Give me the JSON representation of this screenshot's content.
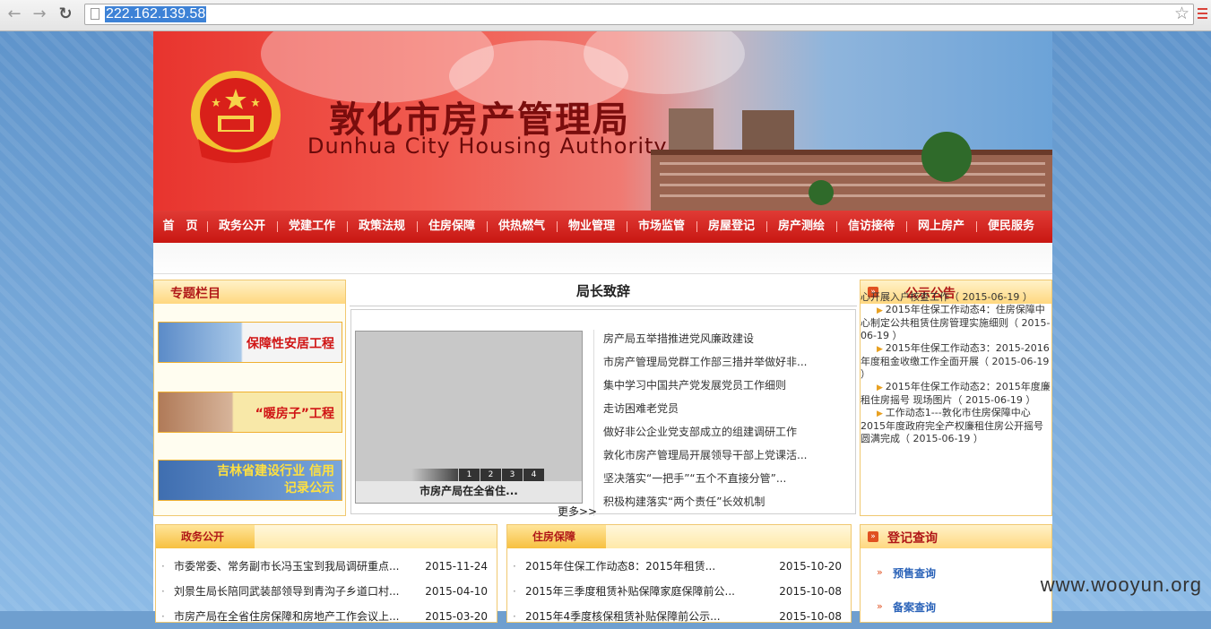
{
  "browser": {
    "url": "222.162.139.58",
    "back_icon": "arrow-left-icon",
    "forward_icon": "arrow-right-icon",
    "reload_icon": "reload-icon"
  },
  "site": {
    "title_cn": "敦化市房产管理局",
    "title_en": "Dunhua City Housing Authority"
  },
  "nav": {
    "items": [
      "首　页",
      "政务公开",
      "党建工作",
      "政策法规",
      "住房保障",
      "供热燃气",
      "物业管理",
      "市场监管",
      "房屋登记",
      "房产测绘",
      "信访接待",
      "网上房产",
      "便民服务"
    ]
  },
  "special": {
    "title": "专题栏目",
    "cards": [
      "保障性安居工程",
      "“暖房子”工程",
      "吉林省建设行业 信用记录公示"
    ]
  },
  "center": {
    "title": "局长致辞",
    "slide_caption": "市房产局在全省住...",
    "slide_pages": [
      "1",
      "2",
      "3",
      "4"
    ],
    "more": "更多>>",
    "news": [
      "房产局五举措推进党风廉政建设",
      "市房产管理局党群工作部三措并举做好非...",
      "集中学习中国共产党发展党员工作细则",
      "走访困难老党员",
      "做好非公企业党支部成立的组建调研工作",
      "敦化市房产管理局开展领导干部上党课活...",
      "坚决落实“一把手”“五个不直接分管”...",
      "积极构建落实“两个责任”长效机制"
    ]
  },
  "notice": {
    "title": "公示公告",
    "lines": [
      "心开展入户核查工作（ 2015-06-19 ）",
      "2015年住保工作动态4：住房保障中心制定公共租赁住房管理实施细则（ 2015-06-19 ）",
      "2015年住保工作动态3：2015-2016年度租金收缴工作全面开展（ 2015-06-19 ）",
      "2015年住保工作动态2：2015年度廉租住房摇号 现场图片（ 2015-06-19 ）",
      "工作动态1---敦化市住房保障中心2015年度政府完全产权廉租住房公开摇号圆满完成（ 2015-06-19 ）"
    ]
  },
  "query": {
    "title": "登记查询",
    "links": [
      "预售查询",
      "备案查询"
    ]
  },
  "gov": {
    "title": "政务公开",
    "rows": [
      {
        "t": "市委常委、常务副市长冯玉宝到我局调研重点...",
        "d": "2015-11-24"
      },
      {
        "t": "刘景生局长陪同武装部领导到青沟子乡道口村...",
        "d": "2015-04-10"
      },
      {
        "t": "市房产局在全省住房保障和房地产工作会议上...",
        "d": "2015-03-20"
      }
    ]
  },
  "housing": {
    "title": "住房保障",
    "rows": [
      {
        "t": "2015年住保工作动态8：2015年租赁...",
        "d": "2015-10-20"
      },
      {
        "t": "2015年三季度租赁补贴保障家庭保障前公...",
        "d": "2015-10-08"
      },
      {
        "t": "2015年4季度核保租赁补贴保障前公示...",
        "d": "2015-10-08"
      }
    ]
  },
  "watermark": "www.wooyun.org"
}
